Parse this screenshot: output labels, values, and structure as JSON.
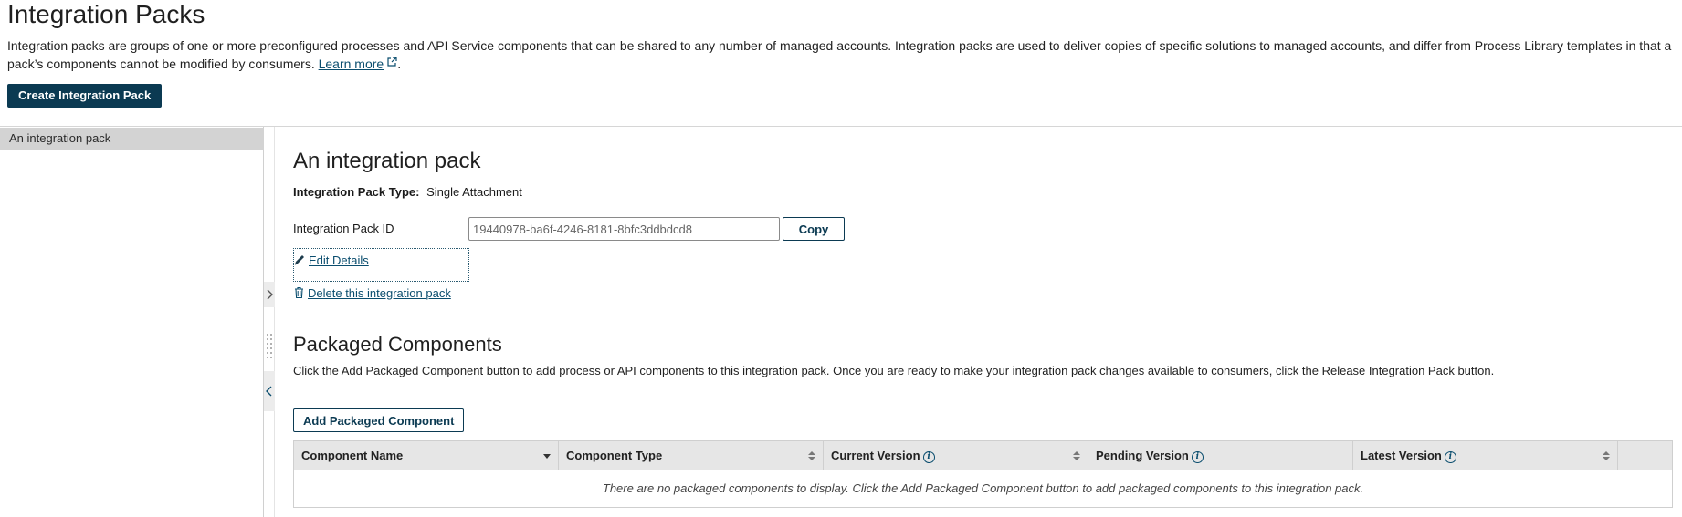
{
  "header": {
    "title": "Integration Packs",
    "description_line1": "Integration packs are groups of one or more preconfigured processes and API Service components that can be shared to any number of managed accounts. Integration packs are used to deliver copies of specific solutions to managed accounts, and differ from Process Library templates in that a pack’s",
    "description_line2": "components cannot be modified by consumers.",
    "learn_more": "Learn more",
    "create_button": "Create Integration Pack"
  },
  "sidebar": {
    "items": [
      {
        "label": "An integration pack",
        "selected": true
      }
    ]
  },
  "detail": {
    "title": "An integration pack",
    "type_label": "Integration Pack Type:",
    "type_value": "Single Attachment",
    "id_label": "Integration Pack ID",
    "id_value": "19440978-ba6f-4246-8181-8bfc3ddbdcd8",
    "copy_button": "Copy",
    "edit_link": "Edit Details",
    "delete_link": "Delete this integration pack"
  },
  "components": {
    "title": "Packaged Components",
    "description": "Click the Add Packaged Component button to add process or API components to this integration pack. Once you are ready to make your integration pack changes available to consumers, click the Release Integration Pack button.",
    "add_button": "Add Packaged Component",
    "columns": [
      {
        "label": "Component Name",
        "info": false,
        "sort": "desc"
      },
      {
        "label": "Component Type",
        "info": false,
        "sort": "none"
      },
      {
        "label": "Current Version",
        "info": true,
        "sort": "none"
      },
      {
        "label": "Pending Version",
        "info": true,
        "sort": "none"
      },
      {
        "label": "Latest Version",
        "info": true,
        "sort": "none"
      }
    ],
    "empty_message": "There are no packaged components to display. Click the Add Packaged Component button to add packaged components to this integration pack."
  },
  "colors": {
    "primary": "#0b3a52",
    "link": "#0a4d6e",
    "selected_bg": "#d3d3d3",
    "table_header_bg": "#e6e6e6"
  }
}
